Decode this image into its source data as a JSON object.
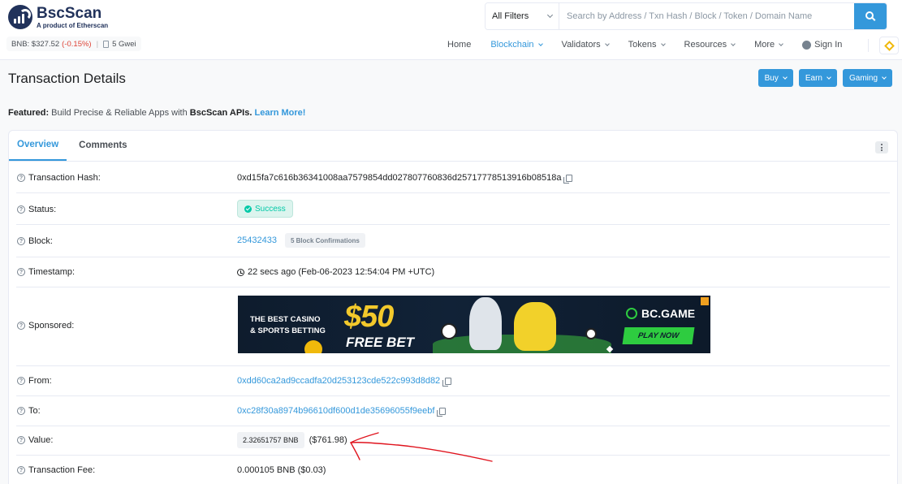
{
  "brand": {
    "name": "BscScan",
    "tagline": "A product of Etherscan"
  },
  "ticker": {
    "price": "BNB: $327.52",
    "change": "(-0.15%)",
    "separator": "|",
    "gas": "5 Gwei"
  },
  "search": {
    "filter_label": "All Filters",
    "placeholder": "Search by Address / Txn Hash / Block / Token / Domain Name"
  },
  "nav": {
    "home": "Home",
    "blockchain": "Blockchain",
    "validators": "Validators",
    "tokens": "Tokens",
    "resources": "Resources",
    "more": "More",
    "sign_in": "Sign In"
  },
  "page": {
    "title": "Transaction Details",
    "buttons": {
      "buy": "Buy",
      "earn": "Earn",
      "gaming": "Gaming"
    },
    "featured": {
      "prefix": "Featured:",
      "text_before": " Build Precise & Reliable Apps with ",
      "brand": "BscScan APIs.",
      "link": "Learn More!"
    }
  },
  "tabs": {
    "overview": "Overview",
    "comments": "Comments"
  },
  "details": {
    "hash": {
      "label": "Transaction Hash:",
      "value": "0xd15fa7c616b36341008aa7579854dd027807760836d25717778513916b08518a"
    },
    "status": {
      "label": "Status:",
      "value": "Success"
    },
    "block": {
      "label": "Block:",
      "value": "25432433",
      "confirmations": "5 Block Confirmations"
    },
    "timestamp": {
      "label": "Timestamp:",
      "value": "22 secs ago (Feb-06-2023 12:54:04 PM +UTC)"
    },
    "sponsored": {
      "label": "Sponsored:"
    },
    "from": {
      "label": "From:",
      "value": "0xdd60ca2ad9ccadfa20d253123cde522c993d8d82"
    },
    "to": {
      "label": "To:",
      "value": "0xc28f30a8974b96610df600d1de35696055f9eebf"
    },
    "value": {
      "label": "Value:",
      "amount": "2.32651757 BNB",
      "usd": "($761.98)"
    },
    "fee": {
      "label": "Transaction Fee:",
      "value": "0.000105 BNB ($0.03)"
    }
  },
  "ad_banner": {
    "headline_line1": "THE BEST CASINO",
    "headline_line2": "& SPORTS BETTING",
    "amount": "$50",
    "offer": "FREE BET",
    "brand": "BC.GAME",
    "cta": "PLAY NOW"
  },
  "annotation": {
    "color": "#e0141e"
  },
  "colors": {
    "accent": "#3498db",
    "success": "#00c9a7",
    "negative": "#de4437",
    "brand_dark": "#21325b"
  }
}
